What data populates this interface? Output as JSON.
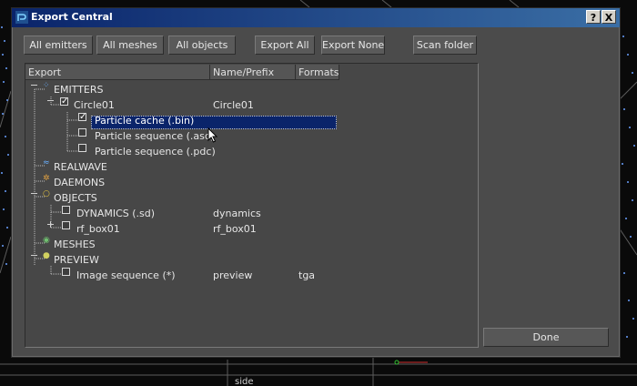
{
  "window": {
    "title": "Export Central",
    "help_label": "?",
    "close_label": "X"
  },
  "toolbar": {
    "all_emitters": "All emitters",
    "all_meshes": "All meshes",
    "all_objects": "All objects",
    "export_all": "Export All",
    "export_none": "Export None",
    "scan_folder": "Scan folder"
  },
  "columns": {
    "export": "Export",
    "name": "Name/Prefix",
    "formats": "Formats"
  },
  "tree": {
    "emitters": "EMITTERS",
    "circle01": {
      "label": "Circle01",
      "name": "Circle01"
    },
    "particle_cache": "Particle cache (.bin)",
    "particle_seq_asc": "Particle sequence (.asc)",
    "particle_seq_pdc": "Particle sequence (.pdc)",
    "realwave": "REALWAVE",
    "daemons": "DAEMONS",
    "objects": "OBJECTS",
    "dynamics": {
      "label": "DYNAMICS (.sd)",
      "name": "dynamics"
    },
    "rf_box01": {
      "label": "rf_box01",
      "name": "rf_box01"
    },
    "meshes": "MESHES",
    "preview": "PREVIEW",
    "image_sequence": {
      "label": "Image sequence (*)",
      "name": "preview",
      "format": "tga"
    }
  },
  "done_label": "Done",
  "viewport": {
    "side_label": "side"
  },
  "colors": {
    "titlebar": "#0a246a",
    "selection": "#0a246a",
    "dialog_bg": "#4b4b4b"
  }
}
